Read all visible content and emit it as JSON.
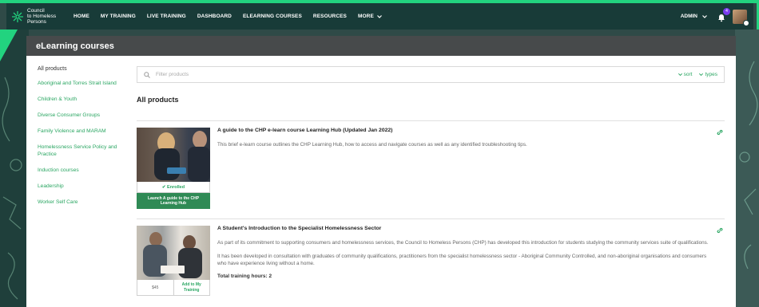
{
  "brand": {
    "line1": "Council",
    "line2": "to Homeless",
    "line3": "Persons"
  },
  "nav": {
    "items": [
      "HOME",
      "MY TRAINING",
      "LIVE TRAINING",
      "DASHBOARD",
      "ELEARNING COURSES",
      "RESOURCES"
    ],
    "more": "MORE",
    "admin": "ADMIN",
    "notifications": "4"
  },
  "page": {
    "title": "eLearning courses"
  },
  "sidebar": {
    "all": "All products",
    "items": [
      "Aboriginal and Torres Strait Island",
      "Children & Youth",
      "Diverse Consumer Groups",
      "Family Violence and MARAM",
      "Homelessness Service Policy and Practice",
      "Induction courses",
      "Leadership",
      "Worker Self Care"
    ]
  },
  "filter": {
    "placeholder": "Filter products",
    "sort": "sort",
    "types": "types"
  },
  "heading": "All products",
  "courses": [
    {
      "title": "A guide to the CHP e-learn course Learning Hub (Updated Jan 2022)",
      "desc": "This brief e-learn course outlines the CHP Learning Hub, how to access and navigate courses as well as any identified troubleshooting tips.",
      "status": "✔ Enrolled",
      "launch": "Launch A guide to the CHP Learning Hub"
    },
    {
      "title": "A Student's Introduction to the Specialist Homelessness Sector",
      "desc": "As part of its commitment to supporting consumers and homelessness services, the Council to Homeless Persons (CHP) has developed this introduction for students studying the community services suite of qualifications.",
      "desc2": "It has been developed in consultation with graduates of community qualifications,  practitioners from the specialist homelessness sector - Aboriginal Community Controlled, and non-aboriginal organisations and consumers who have experience living without a home.",
      "hours": "Total training hours: 2",
      "price": "$45",
      "add": "Add to My Training"
    }
  ],
  "colors": {
    "nav": "#183b38",
    "accent": "#22d37f",
    "link": "#2aa662",
    "header": "#474a4b"
  }
}
